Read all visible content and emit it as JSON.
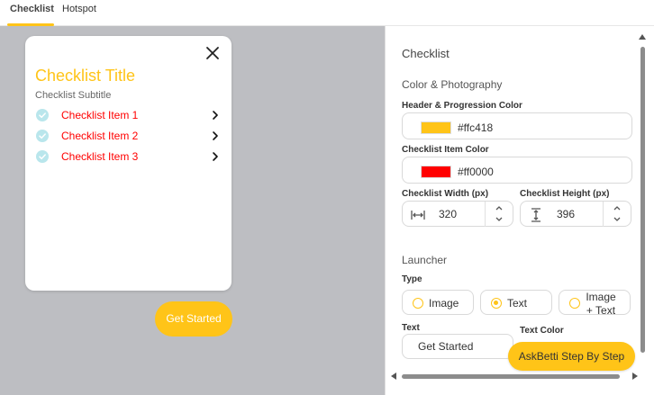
{
  "tabs": [
    {
      "label": "Checklist",
      "active": true
    },
    {
      "label": "Hotspot",
      "active": false
    }
  ],
  "preview": {
    "card": {
      "title": "Checklist Title",
      "subtitle": "Checklist Subtitle",
      "items": [
        {
          "label": "Checklist Item 1"
        },
        {
          "label": "Checklist Item 2"
        },
        {
          "label": "Checklist Item 3"
        }
      ]
    },
    "launcher_label": "Get Started"
  },
  "panel": {
    "title": "Checklist",
    "section_color": "Color & Photography",
    "header_color_label": "Header & Progression Color",
    "header_color_value": "#ffc418",
    "item_color_label": "Checklist Item Color",
    "item_color_value": "#ff0000",
    "width_label": "Checklist Width (px)",
    "width_value": "320",
    "height_label": "Checklist Height (px)",
    "height_value": "396",
    "section_launcher": "Launcher",
    "type_label": "Type",
    "type_options": [
      {
        "label": "Image",
        "selected": false
      },
      {
        "label": "Text",
        "selected": true
      },
      {
        "label": "Image + Text",
        "line1": "Image",
        "line2": "+ Text",
        "selected": false
      }
    ],
    "text_label": "Text",
    "text_value": "Get Started",
    "text_color_label": "Text Color"
  },
  "floating_button_label": "AskBetti Step By Step",
  "colors": {
    "accent": "#ffc418",
    "item": "#ff0000",
    "check": "#b9e6ec",
    "preview_bg": "#bdbec2"
  }
}
